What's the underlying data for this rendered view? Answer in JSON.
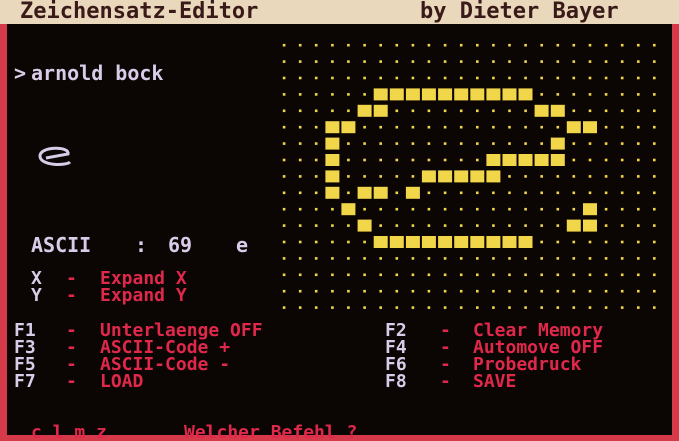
{
  "header": {
    "title_left": "Zeichensatz-Editor",
    "title_right": "by Dieter Bayer"
  },
  "editor": {
    "prompt_symbol": ">",
    "input_text": "arnold bock",
    "ascii_label": "ASCII",
    "ascii_separator": ":",
    "ascii_code": "69",
    "ascii_char": "e"
  },
  "expand": [
    {
      "key": "X",
      "dash": "-",
      "label": "Expand X"
    },
    {
      "key": "Y",
      "dash": "-",
      "label": "Expand Y"
    }
  ],
  "function_keys": {
    "left": [
      {
        "key": "F1",
        "dash": "-",
        "label": "Unterlaenge OFF"
      },
      {
        "key": "F3",
        "dash": "-",
        "label": "ASCII-Code +"
      },
      {
        "key": "F5",
        "dash": "-",
        "label": "ASCII-Code -"
      },
      {
        "key": "F7",
        "dash": "-",
        "label": "LOAD"
      }
    ],
    "right": [
      {
        "key": "F2",
        "dash": "-",
        "label": "Clear Memory"
      },
      {
        "key": "F4",
        "dash": "-",
        "label": "Automove OFF"
      },
      {
        "key": "F6",
        "dash": "-",
        "label": "Probedruck"
      },
      {
        "key": "F8",
        "dash": "-",
        "label": "SAVE"
      }
    ]
  },
  "command_line": {
    "keys": "c l m z",
    "question": "Welcher Befehl ?"
  },
  "glyph": {
    "character": "e",
    "cols": 24,
    "rows": 17,
    "rows_bitmap": [
      "........................",
      "........................",
      "........................",
      "......##########........",
      ".....##.........##......",
      "...##.............##....",
      "...#.............#......",
      "...#.........#####......",
      "...#.....#####..........",
      "...#.##.#...............",
      "....#..............#....",
      ".....#............##....",
      "......##########........",
      "........................",
      "........................",
      "........................",
      "........................"
    ]
  },
  "colors": {
    "background": "#0b0604",
    "title_bar": "#e9d8bc",
    "border": "#d63a4a",
    "text_lavender": "#d9cce8",
    "text_red": "#e0284a",
    "glyph_yellow": "#f2d64a"
  }
}
